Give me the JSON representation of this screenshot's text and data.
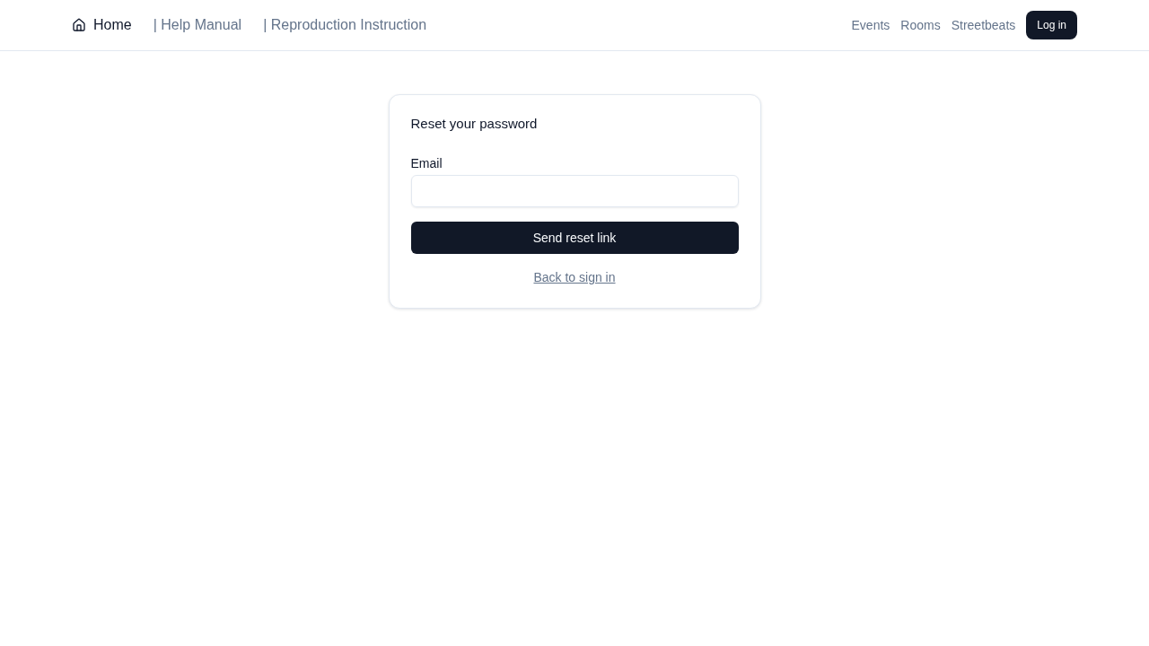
{
  "header": {
    "home_link": {
      "label": "Home"
    },
    "links": [
      {
        "label": "| Help Manual"
      },
      {
        "label": "| Reproduction Instruction"
      }
    ],
    "right_links": [
      {
        "label": "Events"
      },
      {
        "label": "Rooms"
      },
      {
        "label": "Streetbeats"
      }
    ],
    "login_button": {
      "label": "Log in"
    }
  },
  "card": {
    "title": "Reset your password",
    "email_field": {
      "label": "Email"
    },
    "submit_button": {
      "label": "Send reset link"
    },
    "back_link": {
      "label": "Back to sign in"
    }
  }
}
